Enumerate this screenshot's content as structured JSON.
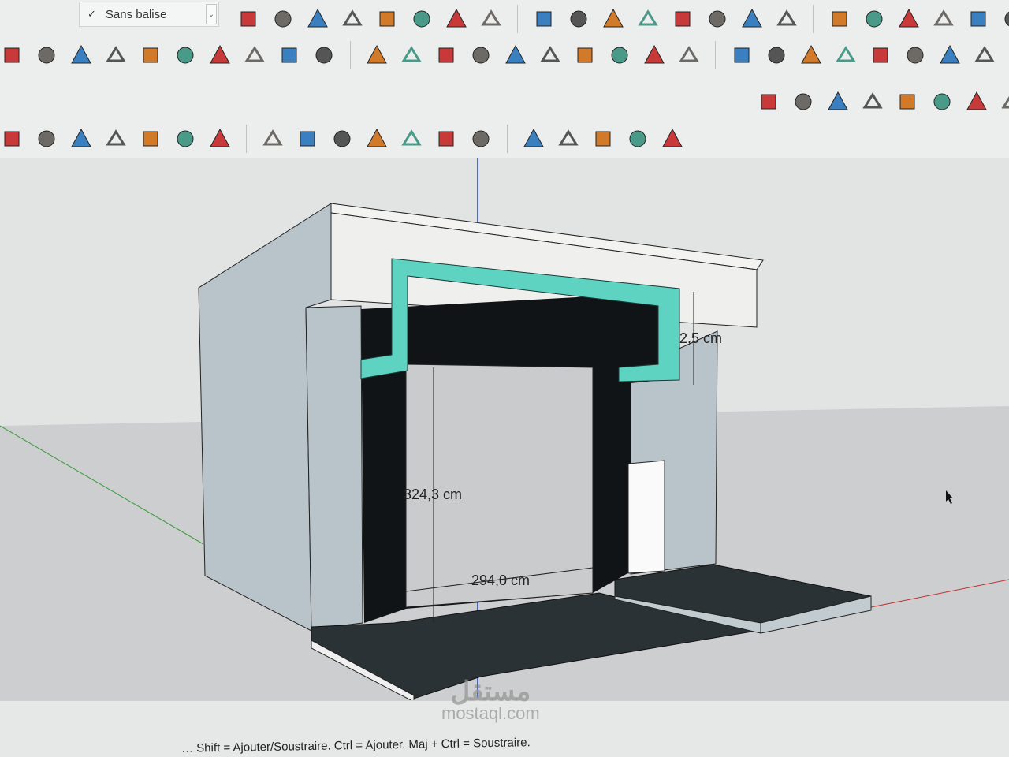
{
  "toolbar": {
    "tag_dropdown": {
      "selected": "Sans balise"
    },
    "row1_icons": [
      "tag-icon",
      "xray-style-icon",
      "back-edges-style-icon",
      "wireframe-style-icon",
      "hidden-line-style-icon",
      "shaded-style-icon",
      "shaded-textures-style-icon",
      "monochrome-style-icon",
      "iso-view-icon",
      "top-view-icon",
      "front-view-icon",
      "right-view-icon",
      "back-view-icon",
      "left-view-icon",
      "component-icon",
      "group-icon",
      "outer-shell-icon",
      "intersect-icon",
      "union-icon",
      "subtract-icon",
      "section-plane-icon",
      "section-display-icon"
    ],
    "row2_icons": [
      "line-icon",
      "freehand-icon",
      "rectangle-icon",
      "rotated-rectangle-icon",
      "circle-icon",
      "polygon-icon",
      "arc-icon",
      "two-point-arc-icon",
      "three-point-arc-icon",
      "pie-icon",
      "move-icon",
      "push-pull-icon",
      "rotate-icon",
      "follow-me-icon",
      "scale-icon",
      "offset-icon",
      "tape-measure-icon",
      "dimension-icon",
      "protractor-icon",
      "text-icon",
      "axes-icon",
      "3d-text-icon",
      "orbit-icon",
      "pan-icon",
      "zoom-icon",
      "zoom-window-icon",
      "zoom-extents-icon",
      "previous-view-icon"
    ],
    "row3_icons": [
      "sandbox-from-contours-icon",
      "sandbox-from-scratch-icon",
      "smoove-icon",
      "stamp-icon",
      "drape-icon",
      "add-detail-icon",
      "flip-edge-icon",
      "sphere-icon"
    ],
    "row4_icons": [
      "arc-dropdown-icon",
      "rectangle-dropdown-icon",
      "push-pull-icon",
      "offset-icon",
      "move-icon",
      "rotate-icon",
      "scale-icon",
      "tape-measure-icon",
      "text-icon",
      "paint-bucket-icon",
      "orbit-icon",
      "pan-icon",
      "zoom-icon",
      "zoom-extents-icon",
      "warehouse-icon",
      "extension-warehouse-icon",
      "layout-icon",
      "extension-manager-icon",
      "account-icon"
    ]
  },
  "viewport": {
    "dimensions": [
      {
        "label": "2,5 cm"
      },
      {
        "label": "324,3 cm"
      },
      {
        "label": "294,0 cm"
      }
    ],
    "colors": {
      "frame": "#5fd3c2",
      "wall": "#b8c4ca",
      "dark": "#101417",
      "floor": "#2b3236",
      "beam": "#f3f3f1"
    }
  },
  "status_bar": {
    "hint": "… Shift = Ajouter/Soustraire. Ctrl = Ajouter. Maj + Ctrl = Soustraire."
  },
  "watermark": {
    "text": "مستقل",
    "sub": "mostaql.com"
  }
}
